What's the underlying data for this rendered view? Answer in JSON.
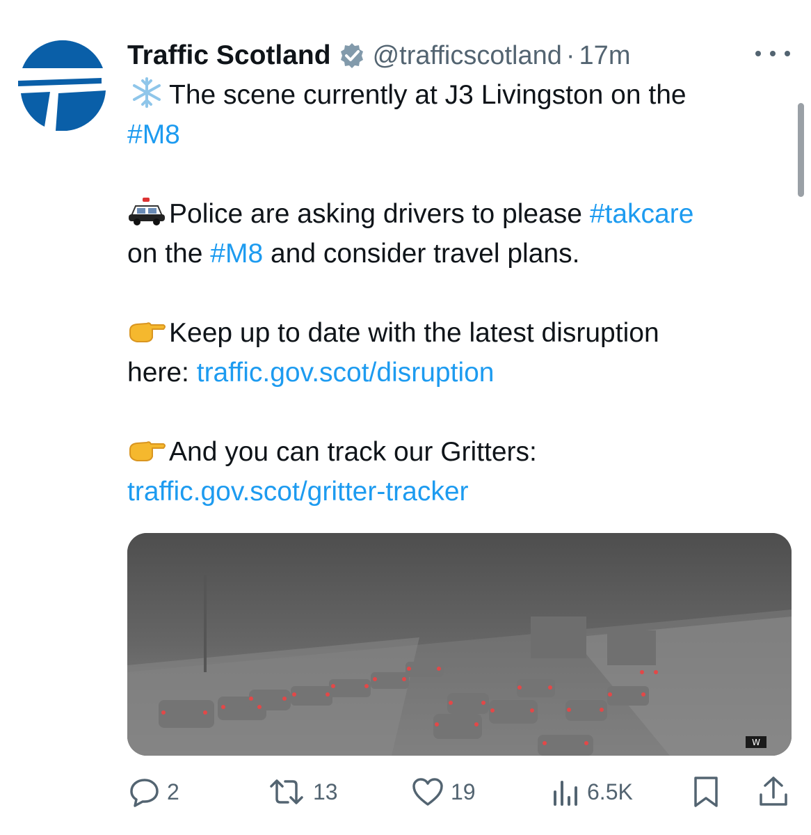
{
  "tweet": {
    "author_name": "Traffic Scotland",
    "handle": "@trafficscotland",
    "separator": "·",
    "time": "17m",
    "lines": {
      "l1": "The scene currently at J3 Livingston on the",
      "l2": "#M8",
      "l3a": "Police are asking drivers to please ",
      "l3b": "#takcare",
      "l4a": "on the ",
      "l4b": "#M8",
      "l4c": " and consider travel plans.",
      "l5": "Keep up to date with the latest disruption",
      "l6a": "here: ",
      "l6b": "traffic.gov.scot/disruption",
      "l7": "And you can track our Gritters:",
      "l8": "traffic.gov.scot/gritter-tracker"
    },
    "media": {
      "watermark": "W"
    }
  },
  "actions": {
    "replies": "2",
    "retweets": "13",
    "likes": "19",
    "views": "6.5K"
  },
  "icons": {
    "verified": "verified-badge-icon",
    "reply": "reply-icon",
    "retweet": "retweet-icon",
    "like": "heart-icon",
    "views": "views-chart-icon",
    "bookmark": "bookmark-icon",
    "share": "share-icon",
    "more": "more-options-icon",
    "snowflake": "snowflake-emoji",
    "police_car": "police-car-emoji",
    "pointing_hand": "pointing-hand-emoji"
  },
  "colors": {
    "link": "#1d9bf0",
    "text": "#0f1419",
    "secondary": "#536471",
    "logo_blue": "#0a5fa8"
  }
}
